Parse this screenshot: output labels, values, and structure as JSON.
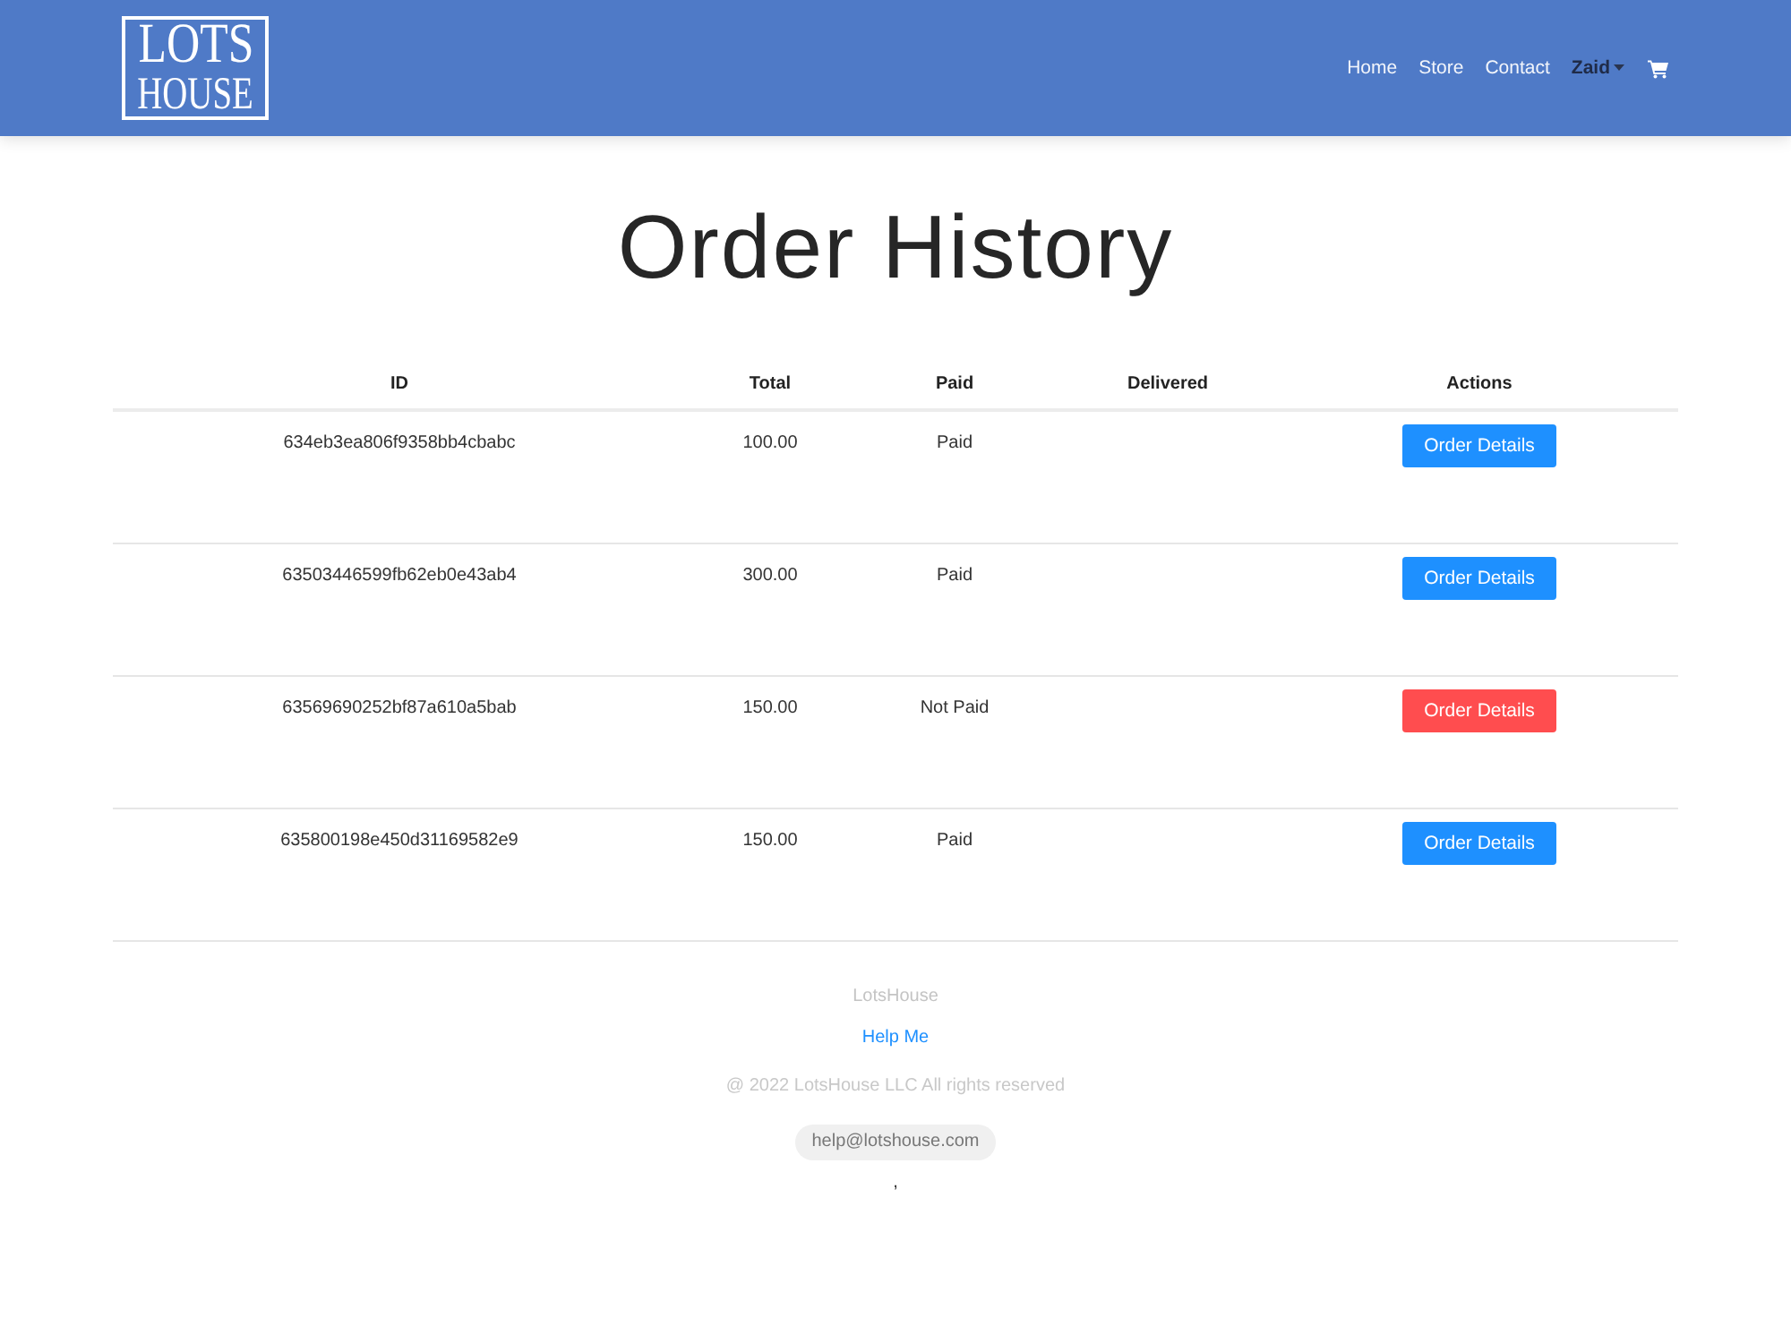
{
  "header": {
    "logo": {
      "lines": [
        "LOTS",
        "HOUSE"
      ]
    },
    "nav": [
      {
        "kind": "link",
        "label": "Home"
      },
      {
        "kind": "link",
        "label": "Store"
      },
      {
        "kind": "link",
        "label": "Contact"
      },
      {
        "kind": "dropdown",
        "label": "Zaid"
      },
      {
        "kind": "cart"
      }
    ]
  },
  "page_title": "Order History",
  "table": {
    "columns": [
      "ID",
      "Total",
      "Paid",
      "Delivered",
      "Actions"
    ],
    "rows": [
      {
        "id": "634eb3ea806f9358bb4cbabc",
        "total": "100.00",
        "paid_label": "Paid",
        "paid": true,
        "action": "Order Details"
      },
      {
        "id": "63503446599fb62eb0e43ab4",
        "total": "300.00",
        "paid_label": "Paid",
        "paid": true,
        "action": "Order Details"
      },
      {
        "id": "63569690252bf87a610a5bab",
        "total": "150.00",
        "paid_label": "Not Paid",
        "paid": false,
        "action": "Order Details"
      },
      {
        "id": "635800198e450d31169582e9",
        "total": "150.00",
        "paid_label": "Paid",
        "paid": true,
        "action": "Order Details"
      }
    ]
  },
  "footer": {
    "brand": "LotsHouse",
    "link": "Help Me",
    "copyright": "@ 2022 LotsHouse LLC All rights reserved",
    "email": "help@lotshouse.com",
    "mark": ","
  }
}
